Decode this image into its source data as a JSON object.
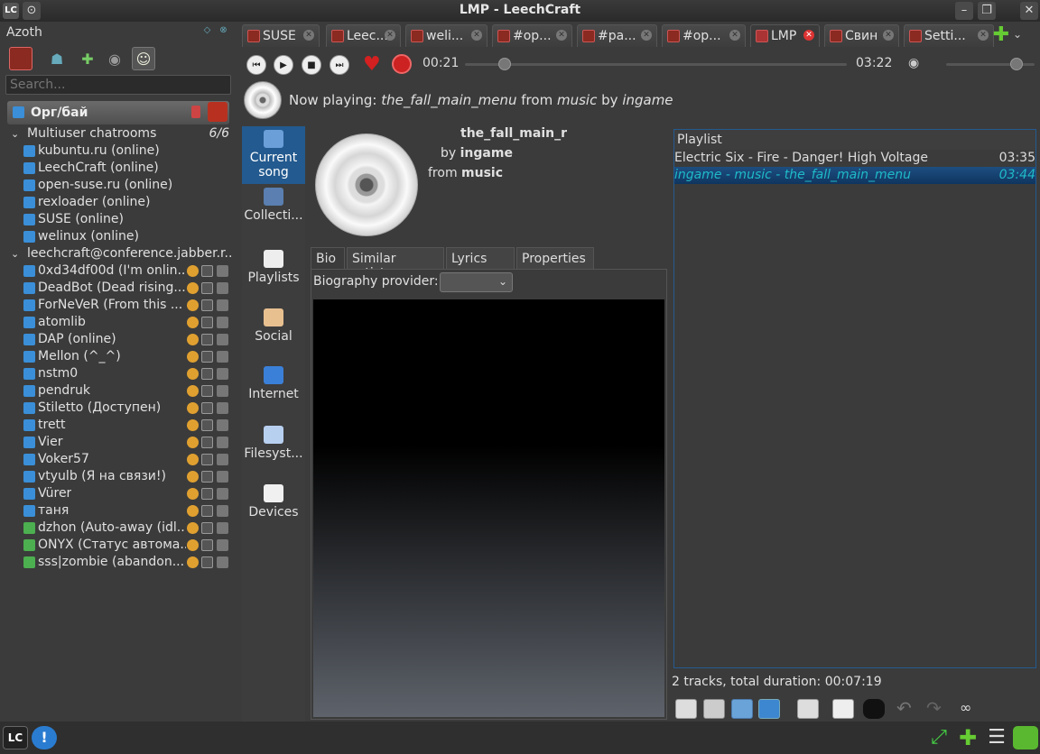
{
  "window": {
    "title": "LMP - LeechCraft"
  },
  "azoth": {
    "panel_title": "Azoth",
    "search_placeholder": "Search...",
    "account": "Орг/бай",
    "groups": [
      {
        "label": "Multiuser chatrooms",
        "count": "6/6",
        "items": [
          "kubuntu.ru (online)",
          "LeechCraft (online)",
          "open-suse.ru (online)",
          "rexloader (online)",
          "SUSE (online)",
          "welinux (online)"
        ]
      },
      {
        "label": "leechcraft@conference.jabber.r...",
        "items": [
          "0xd34df00d (I'm onlin...",
          "DeadBot (Dead rising...)",
          "ForNeVeR (From this ...",
          "atomlib",
          "DAP (online)",
          "Mellon (^_^)",
          "nstm0",
          "pendruk",
          "Stiletto (Доступен)",
          "trett",
          "Vier",
          "Voker57",
          "vtyulb (Я на связи!)",
          "Vürer",
          "таня",
          "dzhon (Auto-away (idl...",
          "ONYX (Статус автома...",
          "sss|zombie (abandon..."
        ]
      }
    ]
  },
  "tabs": [
    "SUSE",
    "Leec...",
    "weli...",
    "#op...",
    "#pa...",
    "#op...",
    "LMP",
    "Свин",
    "Setti..."
  ],
  "player": {
    "elapsed": "00:21",
    "total": "03:22",
    "position": 0.104,
    "volume": 0.8
  },
  "now_playing": {
    "prefix": "Now playing:",
    "track": "the_fall_main_menu",
    "from": "from",
    "album": "music",
    "by": "by",
    "artist": "ingame"
  },
  "sidebar": [
    "Current song",
    "Collecti...",
    "Playlists",
    "Social",
    "Internet",
    "Filesyst...",
    "Devices"
  ],
  "current_song": {
    "title": "the_fall_main_r",
    "by": "by",
    "artist": "ingame",
    "from": "from",
    "album": "music"
  },
  "content_tabs": [
    "Bio",
    "Similar artists",
    "Lyrics",
    "Properties"
  ],
  "bio": {
    "provider_label": "Biography provider:",
    "provider_value": ""
  },
  "playlist": {
    "header": "Playlist",
    "tracks": [
      {
        "name": "Electric Six - Fire - Danger! High Voltage",
        "duration": "03:35"
      },
      {
        "name": "ingame - music - the_fall_main_menu",
        "duration": "03:44"
      }
    ],
    "summary": "2 tracks, total duration: 00:07:19"
  },
  "colors": {
    "accent": "#235a8f",
    "current_track_text": "#1fbac9",
    "online": "#3a8fd8"
  }
}
